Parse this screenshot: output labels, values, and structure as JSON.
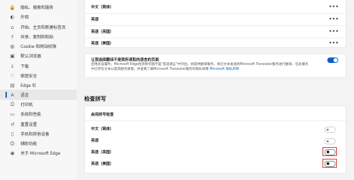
{
  "sidebar": {
    "items": [
      {
        "label": "隐私、搜索和服务",
        "icon": "lock-icon"
      },
      {
        "label": "外观",
        "icon": "appearance-icon"
      },
      {
        "label": "开始、主页和新建标签页",
        "icon": "home-icon"
      },
      {
        "label": "共享、复制和粘贴",
        "icon": "share-icon"
      },
      {
        "label": "Cookie 和网站权限",
        "icon": "cookie-icon"
      },
      {
        "label": "默认浏览器",
        "icon": "browser-icon"
      },
      {
        "label": "下载",
        "icon": "download-icon"
      },
      {
        "label": "家庭安全",
        "icon": "family-icon"
      },
      {
        "label": "Edge 栏",
        "icon": "edge-bar-icon"
      },
      {
        "label": "语言",
        "icon": "language-icon"
      },
      {
        "label": "打印机",
        "icon": "printer-icon"
      },
      {
        "label": "系统和性能",
        "icon": "system-icon"
      },
      {
        "label": "重置设置",
        "icon": "reset-icon"
      },
      {
        "label": "手机和其他设备",
        "icon": "phone-icon"
      },
      {
        "label": "辅助功能",
        "icon": "accessibility-icon"
      },
      {
        "label": "关于 Microsoft Edge",
        "icon": "edge-logo-icon"
      }
    ],
    "active_index": 9
  },
  "preferred_languages": [
    {
      "label": "中文（简体）"
    },
    {
      "label": "英语"
    },
    {
      "label": "英语（英国）"
    },
    {
      "label": "英语（美国）"
    }
  ],
  "translate": {
    "title": "让我选择翻译不是我所读取的语言的页面",
    "description": "启用此设置时，Microsoft Edge检测到页面不是\"首选语言\"中列出，将提供翻译服务。将已文本发送到Microsoft Translator服务进行翻译。在此服务中已存在文本以提高服务质量，并查看了解Microsoft Translator服务的隐私政策",
    "link": "Microsoft 隐私声明",
    "enabled": true
  },
  "spellcheck": {
    "title": "检查拼写",
    "enable_label": "启用拼写检查",
    "languages": [
      {
        "label": "中文（简体）",
        "enabled": false
      },
      {
        "label": "英语",
        "enabled": false
      },
      {
        "label": "英语（英国）",
        "enabled": false
      },
      {
        "label": "英语（美国）",
        "enabled": false
      }
    ]
  }
}
